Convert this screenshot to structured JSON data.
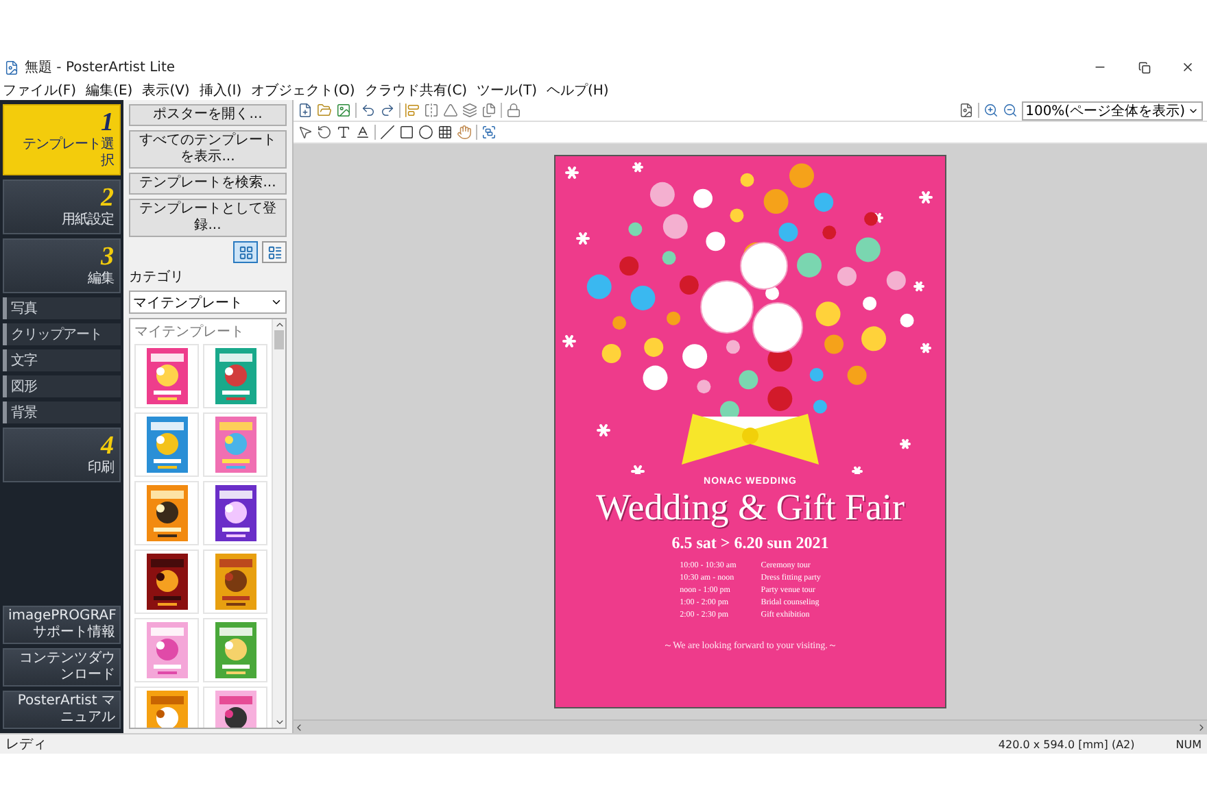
{
  "window": {
    "title": "無題 - PosterArtist Lite"
  },
  "menu": [
    "ファイル(F)",
    "編集(E)",
    "表示(V)",
    "挿入(I)",
    "オブジェクト(O)",
    "クラウド共有(C)",
    "ツール(T)",
    "ヘルプ(H)"
  ],
  "steps": [
    {
      "number": "1",
      "label": "テンプレート選択",
      "selected": true
    },
    {
      "number": "2",
      "label": "用紙設定",
      "selected": false
    },
    {
      "number": "3",
      "label": "編集",
      "selected": false,
      "children": [
        {
          "label": "写真"
        },
        {
          "label": "クリップアート"
        },
        {
          "label": "文字"
        },
        {
          "label": "図形"
        },
        {
          "label": "背景"
        }
      ]
    },
    {
      "number": "4",
      "label": "印刷",
      "selected": false
    }
  ],
  "links": [
    "imagePROGRAF サポート情報",
    "コンテンツダウンロード",
    "PosterArtist マニュアル"
  ],
  "panel": {
    "buttons": [
      "ポスターを開く...",
      "すべてのテンプレートを表示...",
      "テンプレートを検索...",
      "テンプレートとして登録..."
    ],
    "view_modes": [
      {
        "selected": true
      },
      {
        "selected": false
      }
    ],
    "category_label": "カテゴリ",
    "category": "マイテンプレート",
    "list_header": "マイテンプレート",
    "thumbnails": [
      {
        "kind": "picture"
      },
      {
        "kind": "picture"
      },
      {
        "kind": "picture"
      },
      {
        "kind": "picture"
      },
      {
        "kind": "picture"
      },
      {
        "kind": "picture"
      },
      {
        "kind": "picture"
      },
      {
        "kind": "picture"
      },
      {
        "kind": "picture"
      },
      {
        "kind": "picture"
      },
      {
        "kind": "picture"
      },
      {
        "kind": "picture"
      }
    ]
  },
  "zoom": "100%(ページ全体を表示)",
  "poster": {
    "brand": "NONAC WEDDING",
    "title": "Wedding & Gift Fair",
    "dates": "6.5 sat > 6.20 sun 2021",
    "schedule": [
      {
        "time": "10:00 - 10:30 am",
        "event": "Ceremony tour"
      },
      {
        "time": "10:30 am - noon",
        "event": "Dress fitting party"
      },
      {
        "time": "noon - 1:00 pm",
        "event": "Party venue tour"
      },
      {
        "time": "1:00 - 2:00 pm",
        "event": "Bridal counseling"
      },
      {
        "time": "2:00 - 2:30 pm",
        "event": "Gift exhibition"
      }
    ],
    "footer": "～We are looking forward to your visiting.～"
  },
  "status_bar": {
    "message": "レディ",
    "paper": "420.0 x 594.0 [mm] (A2)",
    "indicator": "NUM"
  }
}
